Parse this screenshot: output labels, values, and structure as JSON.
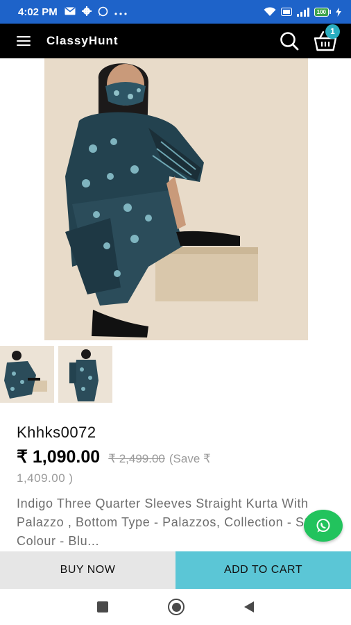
{
  "status_bar": {
    "time": "4:02 PM",
    "icons": [
      "email-icon",
      "settings-icon",
      "whatsapp-icon",
      "more-icon",
      "wifi-icon",
      "volte-icon",
      "signal-icon",
      "battery-icon",
      "charging-icon"
    ],
    "battery": "100"
  },
  "app_bar": {
    "title": "ClassyHunt",
    "cart_count": "1",
    "icons": [
      "menu-icon",
      "search-icon",
      "basket-icon"
    ]
  },
  "product": {
    "code": "Khhks0072",
    "price": "₹ 1,090.00",
    "mrp": "₹ 2,499.00",
    "save_label": "(Save ₹",
    "save_amount": "1,409.00 )",
    "description": "Indigo Three Quarter Sleeves Straight Kurta With Palazzo , Bottom Type - Palazzos, Collection - SS'21, Colour - Blu..."
  },
  "actions": {
    "buy_now": "BUY NOW",
    "add_to_cart": "ADD TO CART"
  },
  "colors": {
    "status_bar": "#1e63c9",
    "app_bar": "#000000",
    "accent": "#5bc6d6",
    "badge": "#2aaec0",
    "whatsapp": "#22c35d"
  }
}
